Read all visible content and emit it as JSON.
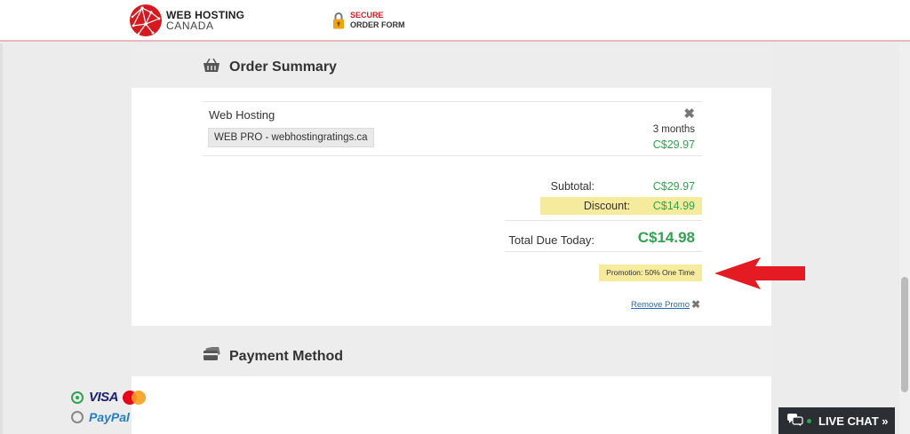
{
  "header": {
    "logo_line1": "WEB HOSTING",
    "logo_line2": "CANADA",
    "secure_line1": "SECURE",
    "secure_line2": "ORDER FORM"
  },
  "order_summary": {
    "title": "Order Summary",
    "item": {
      "name": "Web Hosting",
      "plan": "WEB PRO - webhostingratings.ca",
      "term": "3 months",
      "price": "C$29.97"
    },
    "subtotal_label": "Subtotal:",
    "subtotal_value": "C$29.97",
    "discount_label": "Discount:",
    "discount_value": "C$14.99",
    "total_label": "Total Due Today:",
    "total_value": "C$14.98",
    "promotion": "Promotion: 50% One Time",
    "remove_promo": "Remove Promo"
  },
  "payment": {
    "title": "Payment Method",
    "options": [
      {
        "label": "VISA",
        "selected": true
      },
      {
        "label": "PayPal",
        "selected": false
      }
    ]
  },
  "live_chat": {
    "label": "LIVE CHAT »"
  },
  "colors": {
    "brand_red": "#d7191f",
    "price_green": "#2ea44f",
    "highlight_yellow": "#f6eb9d",
    "link_blue": "#2768b5",
    "arrow_red": "#e41b23"
  }
}
